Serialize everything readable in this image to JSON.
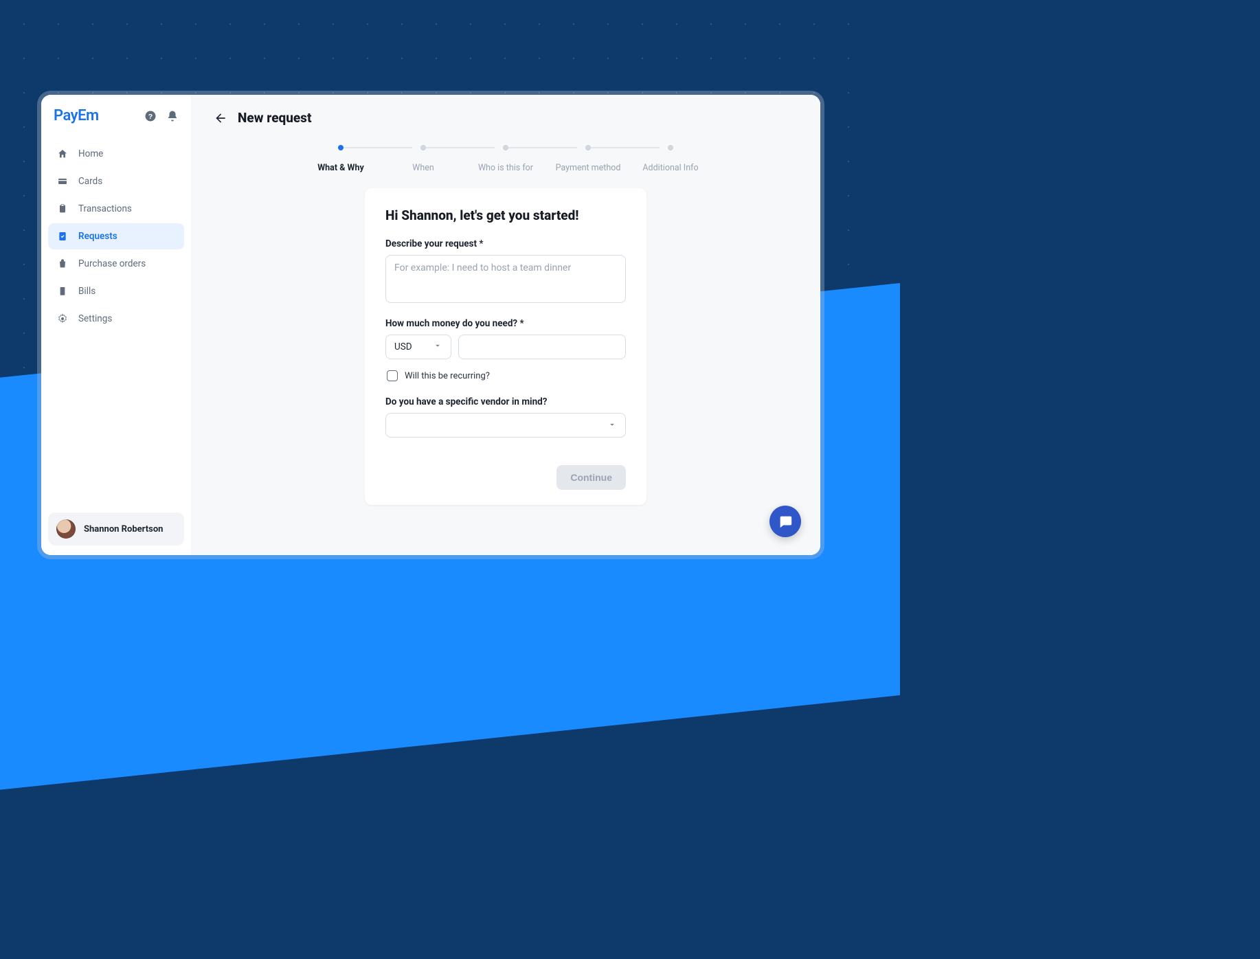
{
  "brand": {
    "name": "PayEm"
  },
  "sidebar": {
    "items": [
      {
        "label": "Home"
      },
      {
        "label": "Cards"
      },
      {
        "label": "Transactions"
      },
      {
        "label": "Requests"
      },
      {
        "label": "Purchase orders"
      },
      {
        "label": "Bills"
      },
      {
        "label": "Settings"
      }
    ]
  },
  "user": {
    "name": "Shannon Robertson"
  },
  "header": {
    "title": "New request"
  },
  "stepper": {
    "steps": [
      {
        "label": "What & Why"
      },
      {
        "label": "When"
      },
      {
        "label": "Who is this for"
      },
      {
        "label": "Payment method"
      },
      {
        "label": "Additional Info"
      }
    ]
  },
  "form": {
    "greeting": "Hi Shannon, let's get you started!",
    "describe": {
      "label": "Describe your request *",
      "placeholder": "For example: I need to host a team dinner",
      "value": ""
    },
    "amount": {
      "label": "How much money do you need? *",
      "currency": "USD",
      "value": ""
    },
    "recurring": {
      "label": "Will this be recurring?",
      "checked": false
    },
    "vendor": {
      "label": "Do you have a specific vendor in mind?",
      "value": ""
    },
    "continue": "Continue"
  }
}
